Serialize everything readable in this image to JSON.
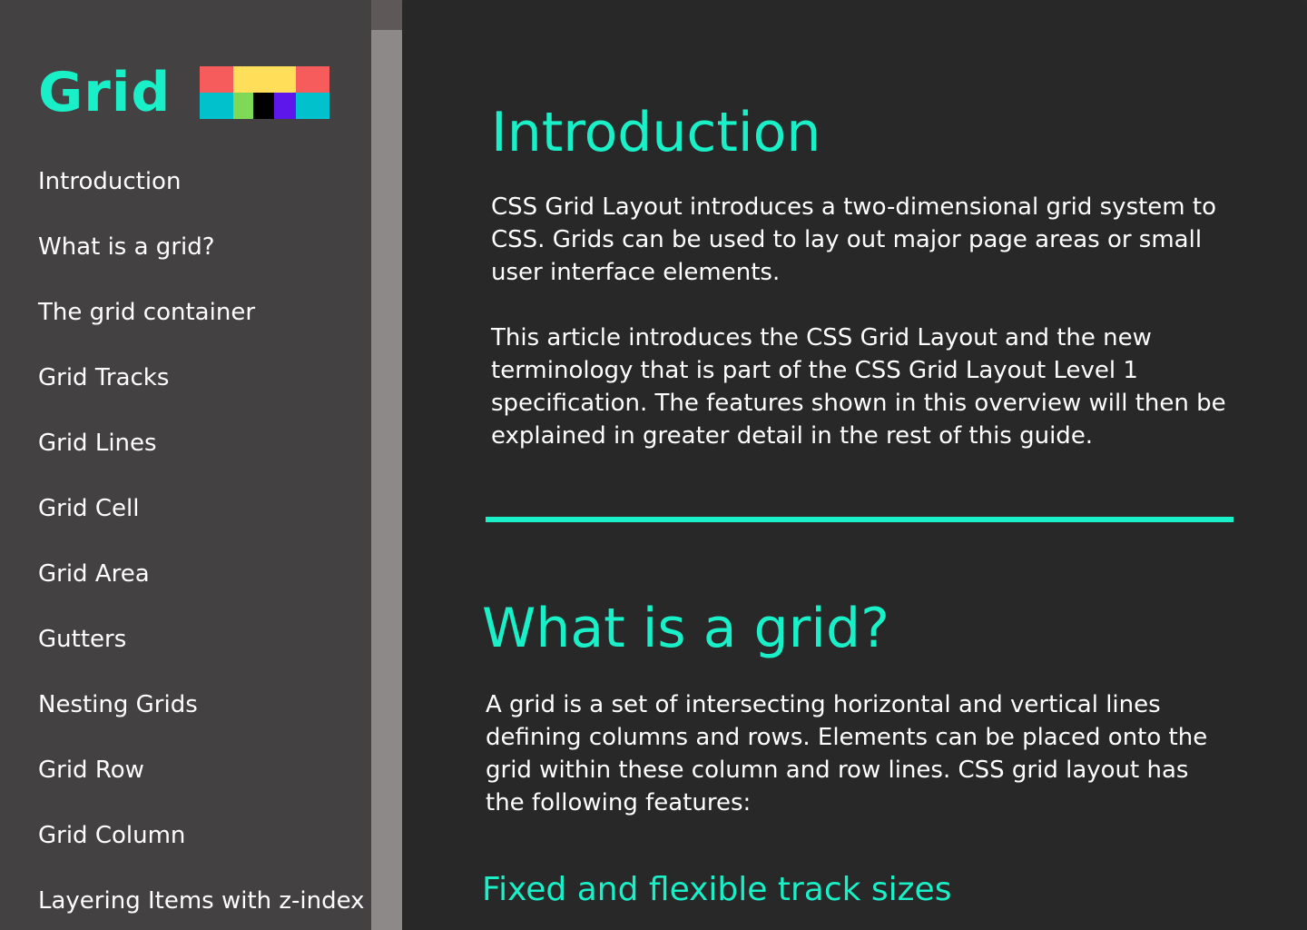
{
  "sidebar": {
    "title": "Grid",
    "logo": {
      "icon": "grid-logo-icon",
      "colors": {
        "coral": "#f75c5c",
        "yellow": "#ffde59",
        "teal": "#00c1cc",
        "green": "#7ed957",
        "black": "#000000",
        "purple": "#5e17eb"
      }
    },
    "items": [
      {
        "label": "Introduction"
      },
      {
        "label": "What is a grid?"
      },
      {
        "label": "The grid container"
      },
      {
        "label": "Grid Tracks"
      },
      {
        "label": "Grid Lines"
      },
      {
        "label": "Grid Cell"
      },
      {
        "label": "Grid Area"
      },
      {
        "label": "Gutters"
      },
      {
        "label": "Nesting Grids"
      },
      {
        "label": "Grid Row"
      },
      {
        "label": "Grid Column"
      },
      {
        "label": "Layering Items with z-index"
      }
    ]
  },
  "main": {
    "sections": [
      {
        "heading": "Introduction",
        "paragraphs": [
          "CSS Grid Layout introduces a two-dimensional grid system to CSS. Grids can be used to lay out major page areas or small user interface elements.",
          "This article introduces the CSS Grid Layout and the new terminology that is part of the CSS Grid Layout Level 1 specification. The features shown in this overview will then be explained in greater detail in the rest of this guide."
        ]
      },
      {
        "heading": "What is a grid?",
        "paragraphs": [
          "A grid is a set of intersecting horizontal and vertical lines defining columns and rows. Elements can be placed onto the grid within these column and row lines. CSS grid layout has the following features:"
        ],
        "subheading": "Fixed and flexible track sizes"
      }
    ]
  },
  "colors": {
    "accent": "#19f0c8",
    "sidebar_bg": "#444143",
    "main_bg": "#282828",
    "scrollbar_track": "#8e8989",
    "scrollbar_thumb": "#5e5859"
  }
}
